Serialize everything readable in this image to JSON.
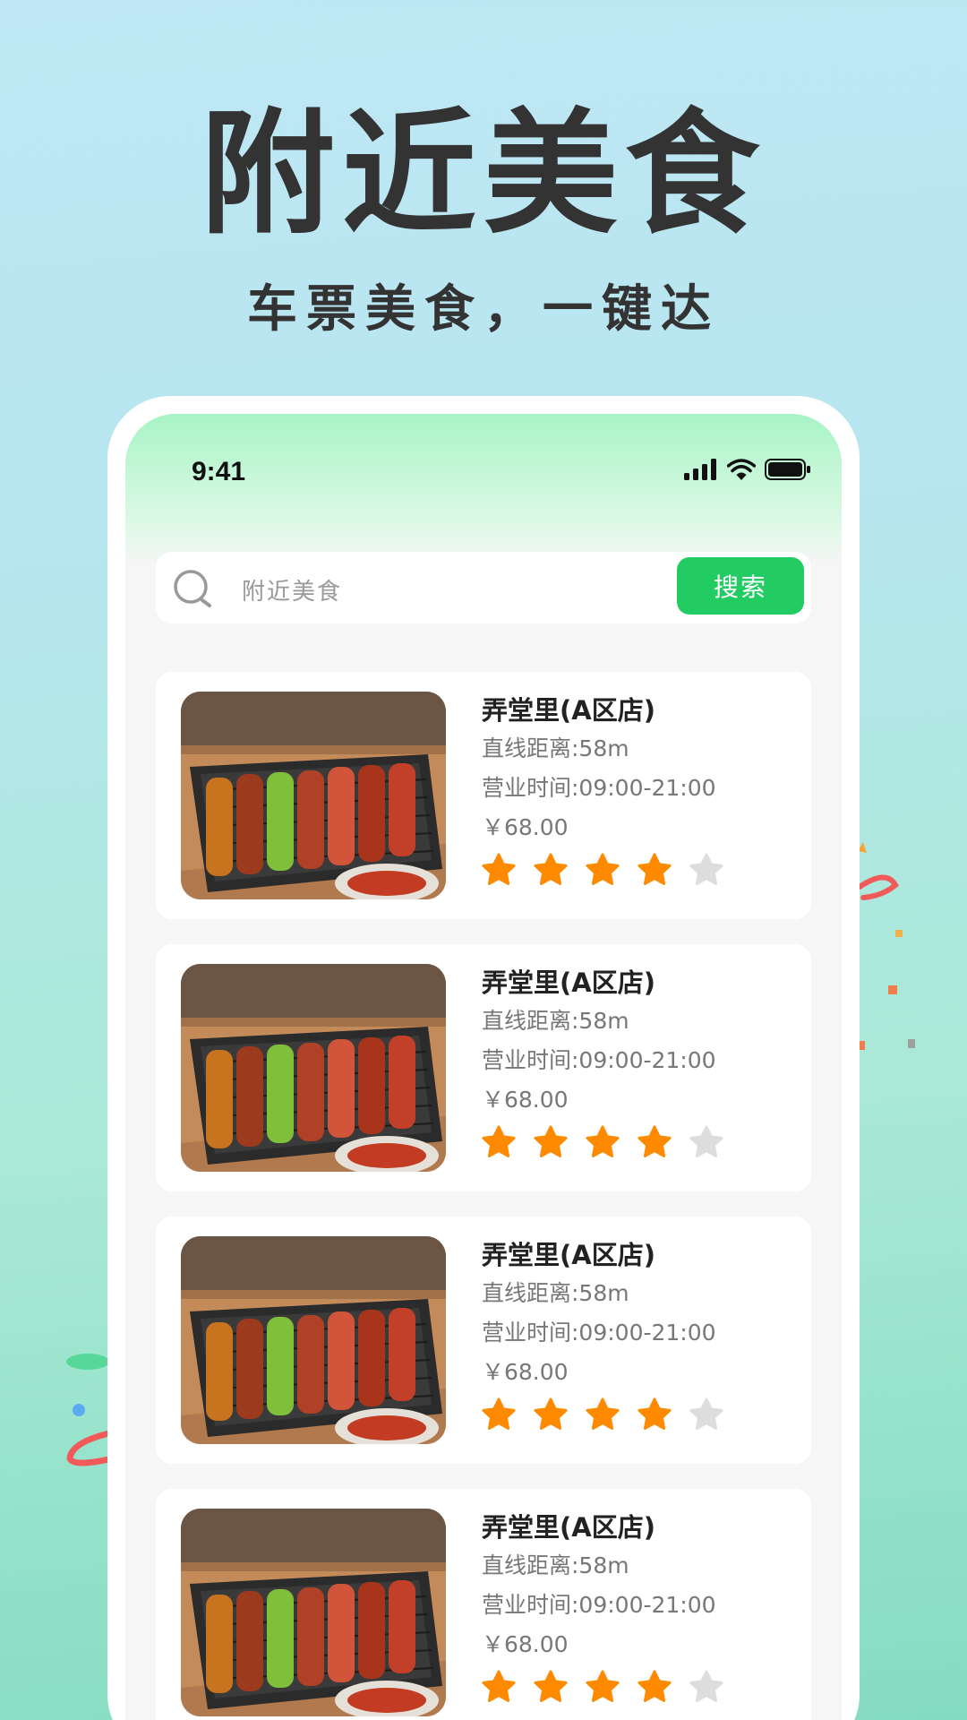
{
  "promo": {
    "title": "附近美食",
    "subtitle": "车票美食，一键达"
  },
  "status_bar": {
    "time": "9:41",
    "icons": [
      "signal-icon",
      "wifi-icon",
      "battery-icon"
    ]
  },
  "search": {
    "placeholder": "附近美食",
    "button_label": "搜索"
  },
  "colors": {
    "accent": "#22cc63",
    "star_active": "#ff8a00",
    "star_inactive": "#dddddd"
  },
  "restaurants": [
    {
      "name": "弄堂里(A区店)",
      "distance": "直线距离:58m",
      "hours": "营业时间:09:00-21:00",
      "price": "￥68.00",
      "rating": 4,
      "rating_max": 5
    },
    {
      "name": "弄堂里(A区店)",
      "distance": "直线距离:58m",
      "hours": "营业时间:09:00-21:00",
      "price": "￥68.00",
      "rating": 4,
      "rating_max": 5
    },
    {
      "name": "弄堂里(A区店)",
      "distance": "直线距离:58m",
      "hours": "营业时间:09:00-21:00",
      "price": "￥68.00",
      "rating": 4,
      "rating_max": 5
    },
    {
      "name": "弄堂里(A区店)",
      "distance": "直线距离:58m",
      "hours": "营业时间:09:00-21:00",
      "price": "￥68.00",
      "rating": 4,
      "rating_max": 5
    }
  ]
}
